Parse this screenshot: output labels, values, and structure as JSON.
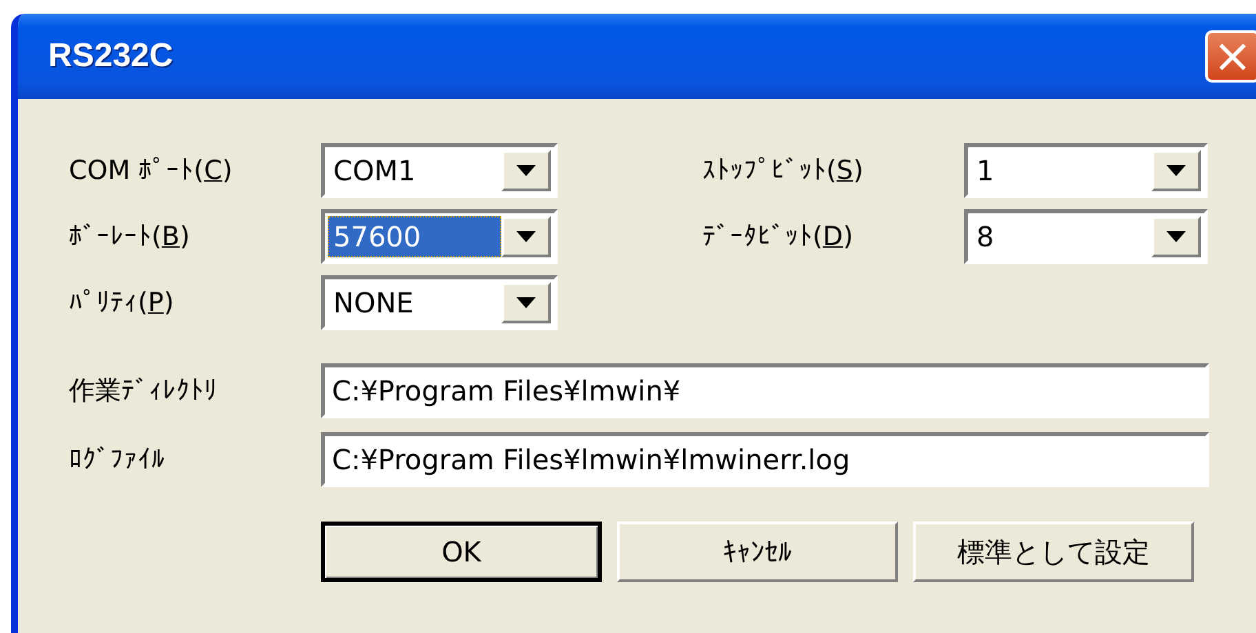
{
  "window": {
    "title": "RS232C",
    "close_button": "×"
  },
  "left_settings": [
    {
      "label": "COM ﾎﾟｰﾄ(",
      "mnemonic": "C",
      "label_end": ")",
      "value": "COM1",
      "focused": false
    },
    {
      "label": "ﾎﾞｰﾚｰﾄ(",
      "mnemonic": "B",
      "label_end": ")",
      "value": "57600",
      "focused": true
    },
    {
      "label": "ﾊﾟﾘﾃｨ(",
      "mnemonic": "P",
      "label_end": ")",
      "value": "NONE",
      "focused": false
    }
  ],
  "right_settings": [
    {
      "label": "ｽﾄｯﾌﾟﾋﾞｯﾄ(",
      "mnemonic": "S",
      "label_end": ")",
      "value": "1",
      "focused": false
    },
    {
      "label": "ﾃﾞｰﾀﾋﾞｯﾄ(",
      "mnemonic": "D",
      "label_end": ")",
      "value": "8",
      "focused": false
    }
  ],
  "paths": [
    {
      "label": "作業ﾃﾞｨﾚｸﾄﾘ",
      "value": "C:¥Program Files¥lmwin¥"
    },
    {
      "label": "ﾛｸﾞﾌｧｲﾙ",
      "value": "C:¥Program Files¥lmwin¥lmwinerr.log"
    }
  ],
  "buttons": [
    {
      "label": "OK",
      "default": true
    },
    {
      "label": "ｷｬﾝｾﾙ",
      "default": false
    },
    {
      "label": "標準として設定",
      "default": false
    }
  ]
}
